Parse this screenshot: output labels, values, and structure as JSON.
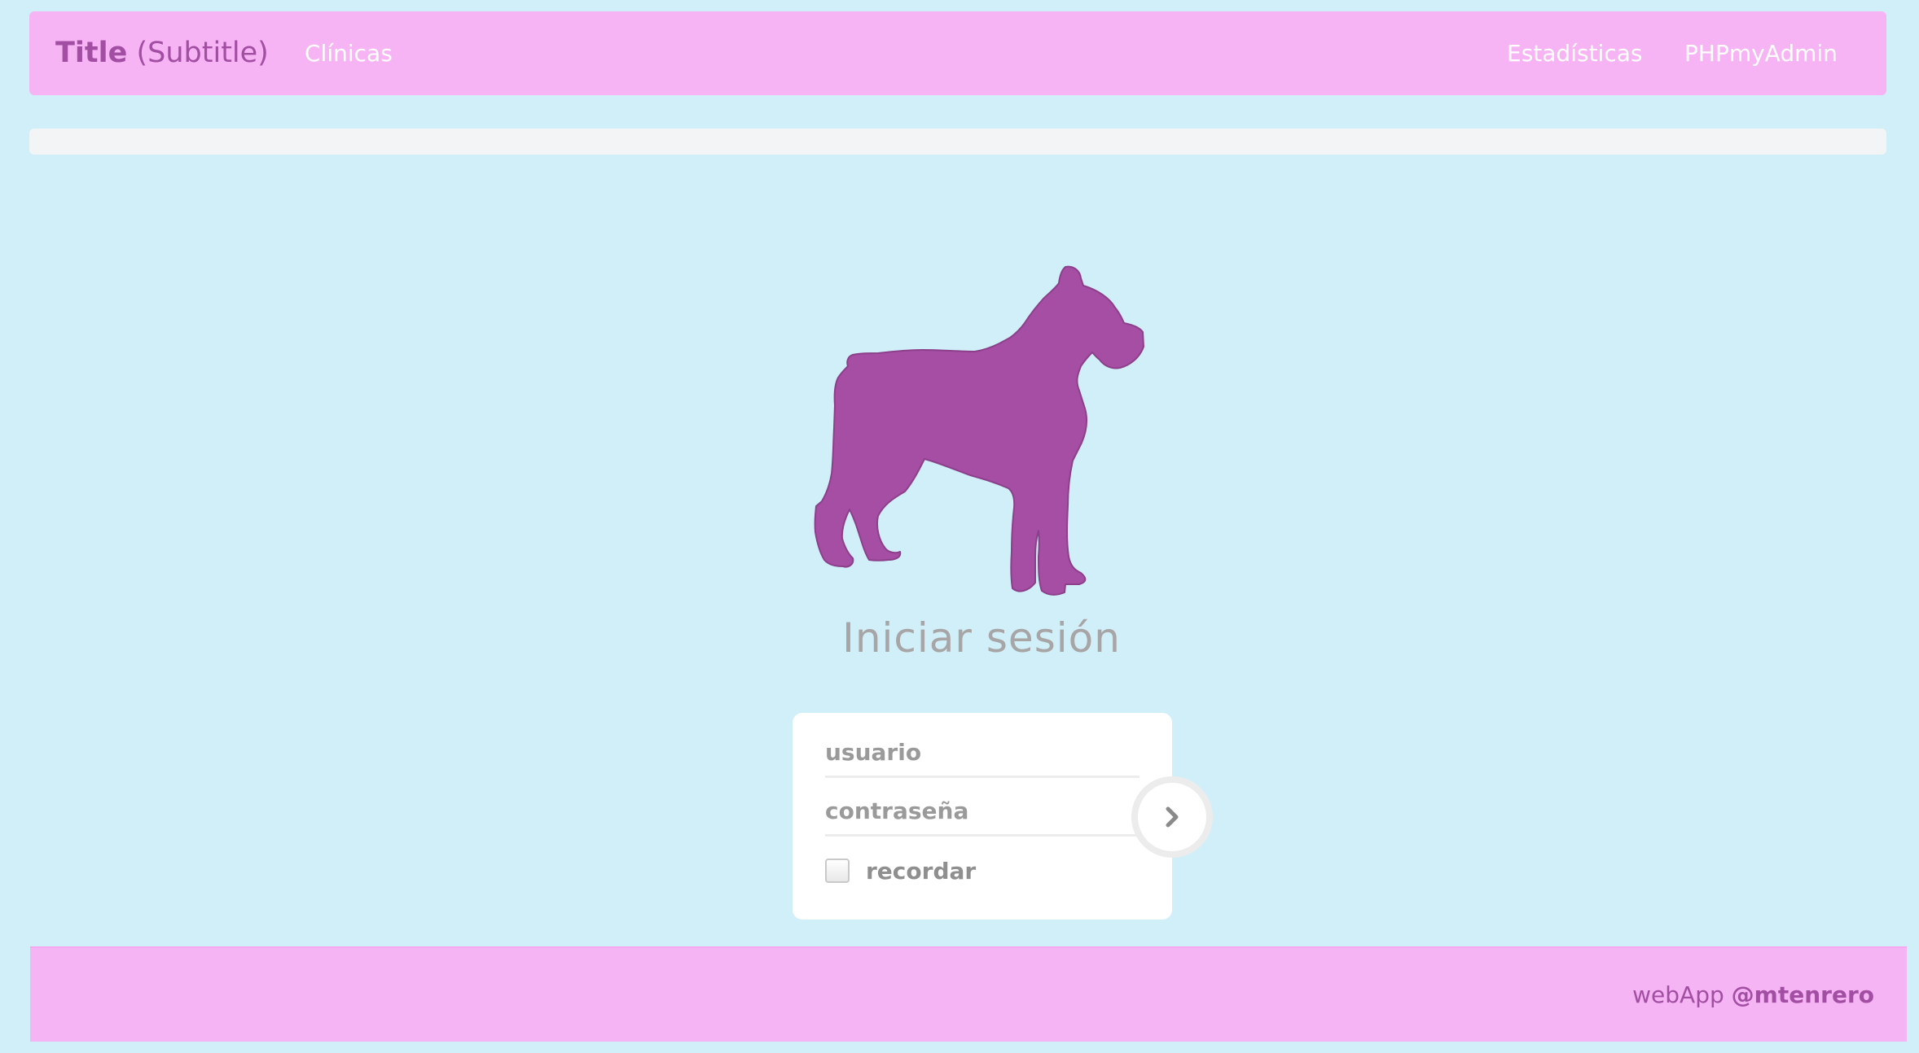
{
  "header": {
    "brand_title": "Title",
    "brand_subtitle": "(Subtitle)",
    "nav_left": [
      "Clínicas"
    ],
    "nav_right": [
      "Estadísticas",
      "PHPmyAdmin"
    ]
  },
  "logo": {
    "icon": "dog-silhouette-icon",
    "color": "#a54ea3"
  },
  "login": {
    "title": "Iniciar sesión",
    "username_placeholder": "usuario",
    "password_placeholder": "contraseña",
    "remember_label": "recordar",
    "remember_checked": false,
    "submit_icon": "chevron-right-icon"
  },
  "footer": {
    "credit_prefix": "webApp",
    "credit_handle": "@mtenrero"
  },
  "colors": {
    "background": "#d0eff9",
    "navbar": "#f7b4f4",
    "accent": "#a14ea3",
    "nav_text": "#ffffff",
    "muted_text": "#a8a5a6"
  }
}
